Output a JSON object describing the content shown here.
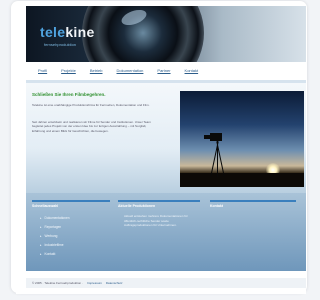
{
  "header": {
    "logo_part1": "tele",
    "logo_part2": "kine",
    "tagline": "fernsehproduktion"
  },
  "nav": {
    "items": [
      "Profil",
      "Projekte",
      "Betrieb",
      "Dokumentation",
      "Partner",
      "Kontakt"
    ]
  },
  "main": {
    "headline": "Schließen Sie Ihren Filmbegehren.",
    "para1": "Telekine ist eine unabhängige Produktionsfirma für Fernsehen, Dokumentation und Film.",
    "para2": "Seit Jahren entwickeln und realisieren wir Filme für Sender und Institutionen. Unser Team begleitet jedes Projekt von der ersten Idee bis zur fertigen Ausstrahlung – mit Sorgfalt, Erfahrung und einem Blick für Geschichten, die bewegen."
  },
  "columns": {
    "col1_title": "Schnellauswahl",
    "col1_links": [
      "Dokumentationen",
      "Reportagen",
      "Werbung",
      "Industriefilme",
      "Kontakt"
    ],
    "col2_title": "Aktuelle Produktionen",
    "col2_text": "Aktuell entstehen mehrere Dokumentationen für öffentlich-rechtliche Sender sowie Auftragsproduktionen für Unternehmen.",
    "col3_title": "Kontakt"
  },
  "footer": {
    "copyright": "© 2005 · Telekine Fernsehproduktion ·",
    "link1": "Impressum",
    "link2": "Datenschutz"
  }
}
